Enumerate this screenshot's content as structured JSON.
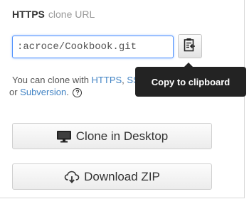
{
  "header": {
    "protocol": "HTTPS",
    "subtitle": "clone URL"
  },
  "url_field": {
    "value": ":acroce/Cookbook.git"
  },
  "help": {
    "prefix": "You can clone with ",
    "link_https": "HTTPS",
    "sep1": ", ",
    "link_ssh": "SSH",
    "sep2": ",",
    "mid": " or ",
    "link_subversion": "Subversion",
    "suffix": ".",
    "help_icon_glyph": "?"
  },
  "tooltip": {
    "text": "Copy to clipboard"
  },
  "buttons": {
    "clone_label": "Clone in Desktop",
    "download_label": "Download ZIP"
  },
  "icons": {
    "clipboard": "clipboard-icon",
    "monitor": "monitor-icon",
    "cloud_download": "cloud-download-icon",
    "help": "help-icon"
  },
  "colors": {
    "link": "#4183c4",
    "focus_border": "#4d90fe",
    "tooltip_bg": "#232323"
  }
}
